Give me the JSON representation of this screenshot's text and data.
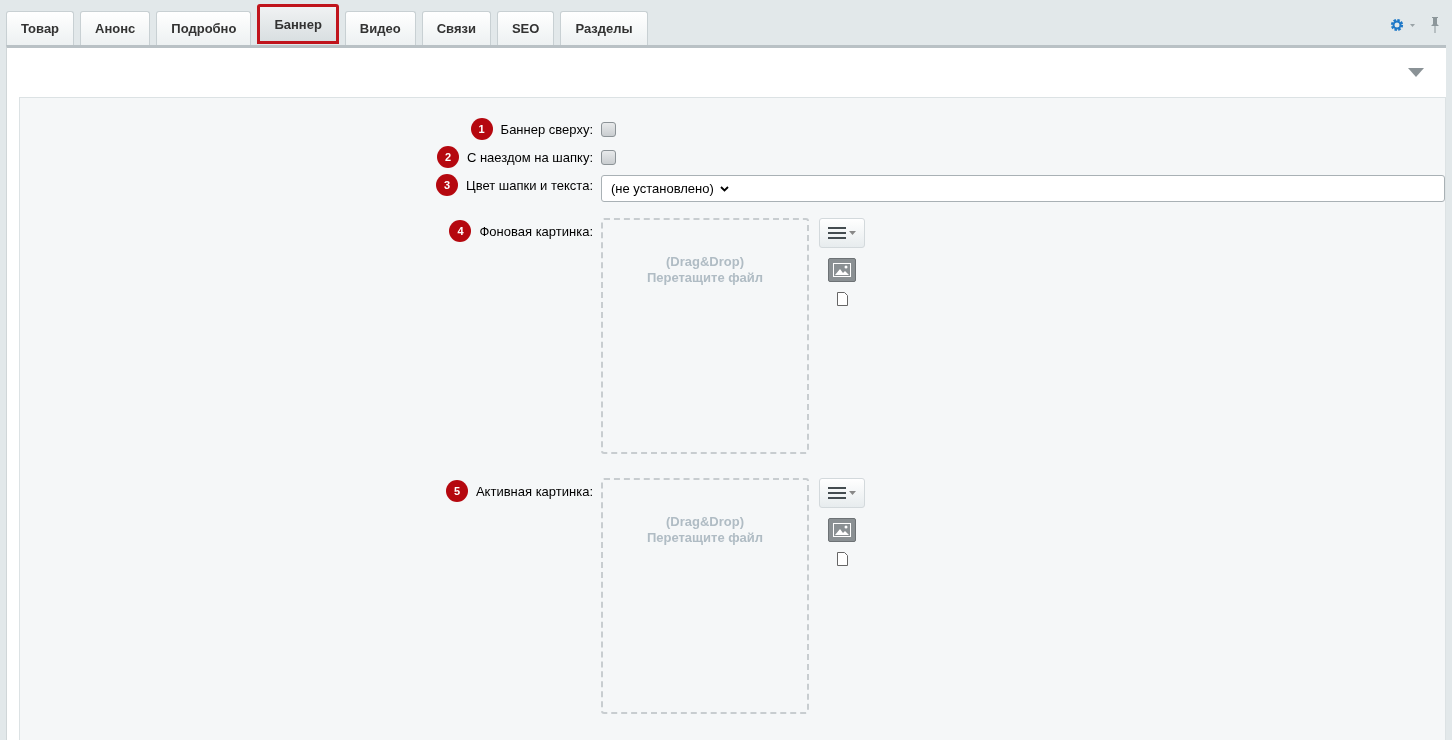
{
  "tabs": [
    {
      "label": "Товар",
      "selected": false
    },
    {
      "label": "Анонс",
      "selected": false
    },
    {
      "label": "Подробно",
      "selected": false
    },
    {
      "label": "Баннер",
      "selected": true
    },
    {
      "label": "Видео",
      "selected": false
    },
    {
      "label": "Связи",
      "selected": false
    },
    {
      "label": "SEO",
      "selected": false
    },
    {
      "label": "Разделы",
      "selected": false
    }
  ],
  "fields": [
    {
      "kind": "checkbox",
      "badge": "1",
      "label": "Баннер сверху:",
      "checked": false
    },
    {
      "kind": "checkbox",
      "badge": "2",
      "label": "С наездом на шапку:",
      "checked": false
    },
    {
      "kind": "select",
      "badge": "3",
      "label": "Цвет шапки и текста:",
      "value": "(не установлено)"
    },
    {
      "kind": "file",
      "badge": "4",
      "label": "Фоновая картинка:",
      "drop_lines": [
        "(Drag&Drop)",
        "Перетащите файл"
      ]
    },
    {
      "kind": "file",
      "badge": "5",
      "label": "Активная картинка:",
      "drop_lines": [
        "(Drag&Drop)",
        "Перетащите файл"
      ]
    }
  ]
}
